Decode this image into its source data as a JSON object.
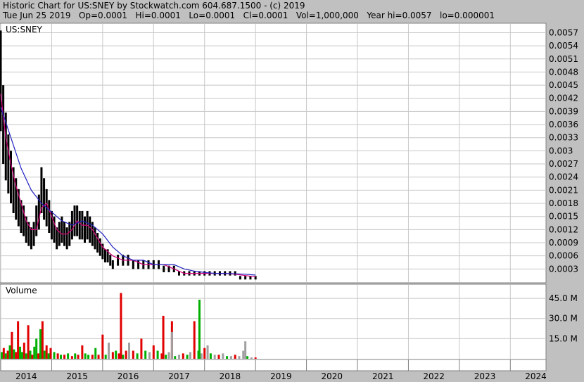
{
  "header": {
    "line1": "Historic Chart for US:SNEY by Stockwatch.com 604.687.1500 - (c) 2019",
    "line2": "Tue Jun 25 2019   Op=0.0001   Hi=0.0001   Lo=0.0001   Cl=0.0001   Vol=1,000,000   Year hi=0.0057   lo=0.000001"
  },
  "colors": {
    "background": "#c0c0c0",
    "panel": "#ffffff",
    "grid": "#c8c8c8",
    "price_bar": "#000000",
    "ma_short": "#d4007a",
    "ma_long": "#2020c0",
    "volume_up": "#00b000",
    "volume_down": "#e00000",
    "volume_flat": "#a0a0a0"
  },
  "chart_data": [
    {
      "type": "line",
      "label": "US:SNEY",
      "y_ticks": [
        "0.0057",
        "0.0054",
        "0.0051",
        "0.0048",
        "0.0045",
        "0.0042",
        "0.0039",
        "0.0036",
        "0.0033",
        "0.003",
        "0.0027",
        "0.0024",
        "0.0021",
        "0.0018",
        "0.0015",
        "0.0012",
        "0.0009",
        "0.0006",
        "0.0003"
      ],
      "ylim": [
        0,
        0.0059
      ],
      "x_ticks": [
        "2014",
        "2015",
        "2016",
        "2017",
        "2018",
        "2019",
        "2020",
        "2021",
        "2022",
        "2023",
        "2024"
      ],
      "xlim": [
        2014.0,
        2024.7
      ],
      "series": [
        {
          "style": "price_bars",
          "x": [
            2014.0,
            2014.05,
            2014.1,
            2014.15,
            2014.2,
            2014.25,
            2014.3,
            2014.35,
            2014.4,
            2014.45,
            2014.5,
            2014.55,
            2014.6,
            2014.65,
            2014.7,
            2014.75,
            2014.8,
            2014.85,
            2014.9,
            2014.95,
            2015.0,
            2015.05,
            2015.1,
            2015.15,
            2015.2,
            2015.25,
            2015.3,
            2015.35,
            2015.4,
            2015.45,
            2015.5,
            2015.55,
            2015.6,
            2015.65,
            2015.7,
            2015.75,
            2015.8,
            2015.85,
            2015.9,
            2015.95,
            2016.0,
            2016.05,
            2016.1,
            2016.15,
            2016.2,
            2016.3,
            2016.4,
            2016.5,
            2016.6,
            2016.7,
            2016.8,
            2016.9,
            2017.0,
            2017.1,
            2017.2,
            2017.3,
            2017.4,
            2017.5,
            2017.6,
            2017.7,
            2017.8,
            2017.9,
            2018.0,
            2018.1,
            2018.2,
            2018.3,
            2018.4,
            2018.5,
            2018.6,
            2018.7,
            2018.8,
            2018.9,
            2019.0
          ],
          "values": [
            0.0046,
            0.0036,
            0.0031,
            0.0027,
            0.0024,
            0.0021,
            0.0019,
            0.0017,
            0.0015,
            0.0014,
            0.0012,
            0.0011,
            0.001,
            0.0011,
            0.0014,
            0.0016,
            0.0021,
            0.0019,
            0.0017,
            0.0015,
            0.0013,
            0.0012,
            0.001,
            0.0011,
            0.0012,
            0.0011,
            0.001,
            0.0011,
            0.0013,
            0.0014,
            0.0014,
            0.0013,
            0.0013,
            0.0012,
            0.0013,
            0.0012,
            0.0011,
            0.001,
            0.0009,
            0.0008,
            0.0007,
            0.0006,
            0.0006,
            0.0005,
            0.0004,
            0.0005,
            0.0005,
            0.0005,
            0.0004,
            0.0004,
            0.0004,
            0.0004,
            0.0004,
            0.0004,
            0.0003,
            0.0003,
            0.0003,
            0.0002,
            0.0002,
            0.0002,
            0.0002,
            0.0002,
            0.0002,
            0.0002,
            0.0002,
            0.0002,
            0.0002,
            0.0002,
            0.0002,
            0.0001,
            0.0001,
            0.0001,
            0.0001
          ]
        },
        {
          "style": "line",
          "color_key": "ma_short",
          "x": [
            2014.0,
            2014.1,
            2014.2,
            2014.3,
            2014.4,
            2014.5,
            2014.6,
            2014.7,
            2014.8,
            2014.9,
            2015.0,
            2015.1,
            2015.2,
            2015.3,
            2015.4,
            2015.5,
            2015.6,
            2015.7,
            2015.8,
            2015.9,
            2016.0,
            2016.1,
            2016.2,
            2016.4,
            2016.6,
            2016.8,
            2017.0,
            2017.2,
            2017.4,
            2017.6,
            2017.8,
            2018.0,
            2018.2,
            2018.4,
            2018.6,
            2018.8,
            2019.0
          ],
          "values": [
            0.0043,
            0.0033,
            0.0027,
            0.0022,
            0.0018,
            0.0014,
            0.0012,
            0.0012,
            0.0017,
            0.0018,
            0.0015,
            0.0012,
            0.0011,
            0.0011,
            0.0012,
            0.0014,
            0.0013,
            0.0013,
            0.0012,
            0.001,
            0.0008,
            0.0007,
            0.0006,
            0.0005,
            0.0005,
            0.0004,
            0.0004,
            0.0004,
            0.0003,
            0.0002,
            0.0002,
            0.0002,
            0.0002,
            0.0002,
            0.00018,
            0.00015,
            0.00012
          ]
        },
        {
          "style": "line",
          "color_key": "ma_long",
          "x": [
            2014.0,
            2014.2,
            2014.4,
            2014.6,
            2014.8,
            2015.0,
            2015.2,
            2015.4,
            2015.6,
            2015.8,
            2016.0,
            2016.2,
            2016.4,
            2016.6,
            2016.8,
            2017.0,
            2017.2,
            2017.4,
            2017.6,
            2017.8,
            2018.0,
            2018.2,
            2018.4,
            2018.6,
            2018.8,
            2019.0
          ],
          "values": [
            0.004,
            0.0033,
            0.0026,
            0.0021,
            0.0018,
            0.0016,
            0.0014,
            0.0013,
            0.0014,
            0.0013,
            0.0011,
            0.0008,
            0.0006,
            0.0005,
            0.0005,
            0.0004,
            0.0004,
            0.0004,
            0.0003,
            0.00025,
            0.00022,
            0.0002,
            0.0002,
            0.00019,
            0.00018,
            0.00016
          ]
        }
      ]
    },
    {
      "type": "bar",
      "title": "Volume",
      "y_ticks": [
        "45.0 M",
        "30.0 M",
        "15.0 M"
      ],
      "ylim": [
        0,
        55
      ],
      "x": [
        2014.02,
        2014.06,
        2014.1,
        2014.14,
        2014.18,
        2014.22,
        2014.26,
        2014.3,
        2014.34,
        2014.38,
        2014.42,
        2014.46,
        2014.5,
        2014.54,
        2014.58,
        2014.62,
        2014.66,
        2014.7,
        2014.74,
        2014.78,
        2014.82,
        2014.86,
        2014.9,
        2014.94,
        2014.98,
        2015.05,
        2015.12,
        2015.18,
        2015.25,
        2015.32,
        2015.4,
        2015.46,
        2015.52,
        2015.6,
        2015.66,
        2015.72,
        2015.8,
        2015.86,
        2015.92,
        2016.0,
        2016.06,
        2016.12,
        2016.2,
        2016.26,
        2016.32,
        2016.4,
        2016.46,
        2016.52,
        2016.6,
        2016.68,
        2016.76,
        2016.84,
        2016.92,
        2017.0,
        2017.08,
        2017.16,
        2017.24,
        2017.3,
        2017.36,
        2017.42,
        2017.5,
        2017.58,
        2017.66,
        2017.72,
        2017.8,
        2017.88,
        2017.94,
        2018.0,
        2018.06,
        2018.12,
        2018.2,
        2018.28,
        2018.36,
        2018.44,
        2018.52,
        2018.6,
        2018.68,
        2018.76,
        2018.84,
        2018.92,
        2019.0
      ],
      "values": [
        5,
        8,
        4,
        6,
        10,
        20,
        7,
        5,
        28,
        9,
        5,
        12,
        4,
        25,
        6,
        3,
        9,
        15,
        4,
        22,
        28,
        6,
        10,
        4,
        8,
        5,
        4,
        3,
        3,
        4,
        2,
        4,
        3,
        10,
        4,
        3,
        3,
        8,
        3,
        18,
        3,
        12,
        5,
        6,
        4,
        3,
        6,
        12,
        6,
        4,
        15,
        6,
        5,
        10,
        6,
        4,
        3,
        5,
        4,
        2,
        3,
        4,
        3,
        5,
        28,
        6,
        4,
        8,
        10,
        4,
        3,
        3,
        4,
        2,
        2,
        3,
        2,
        6,
        2,
        1,
        1
      ],
      "highlights": [
        {
          "x": 2016.36,
          "value": 49,
          "dir": "down"
        },
        {
          "x": 2017.19,
          "value": 32,
          "dir": "down"
        },
        {
          "x": 2017.36,
          "value": 28,
          "dir": "down"
        },
        {
          "x": 2017.9,
          "value": 44,
          "dir": "up"
        },
        {
          "x": 2017.36,
          "value": 20,
          "dir": "flat"
        },
        {
          "x": 2018.8,
          "value": 13,
          "dir": "flat"
        }
      ],
      "dirs": [
        "up",
        "down",
        "up",
        "down",
        "up",
        "down",
        "up",
        "down",
        "down",
        "up",
        "up",
        "down",
        "up",
        "down",
        "up",
        "down",
        "up",
        "up",
        "down",
        "up",
        "down",
        "up",
        "down",
        "up",
        "down",
        "up",
        "down",
        "up",
        "down",
        "up",
        "down",
        "up",
        "down",
        "down",
        "up",
        "up",
        "down",
        "up",
        "down",
        "down",
        "up",
        "flat",
        "down",
        "up",
        "down",
        "up",
        "down",
        "flat",
        "down",
        "up",
        "down",
        "up",
        "flat",
        "down",
        "up",
        "down",
        "up",
        "flat",
        "down",
        "up",
        "flat",
        "down",
        "up",
        "flat",
        "down",
        "up",
        "flat",
        "down",
        "flat",
        "up",
        "flat",
        "down",
        "flat",
        "up",
        "flat",
        "down",
        "flat",
        "flat",
        "up",
        "flat",
        "down"
      ]
    }
  ]
}
